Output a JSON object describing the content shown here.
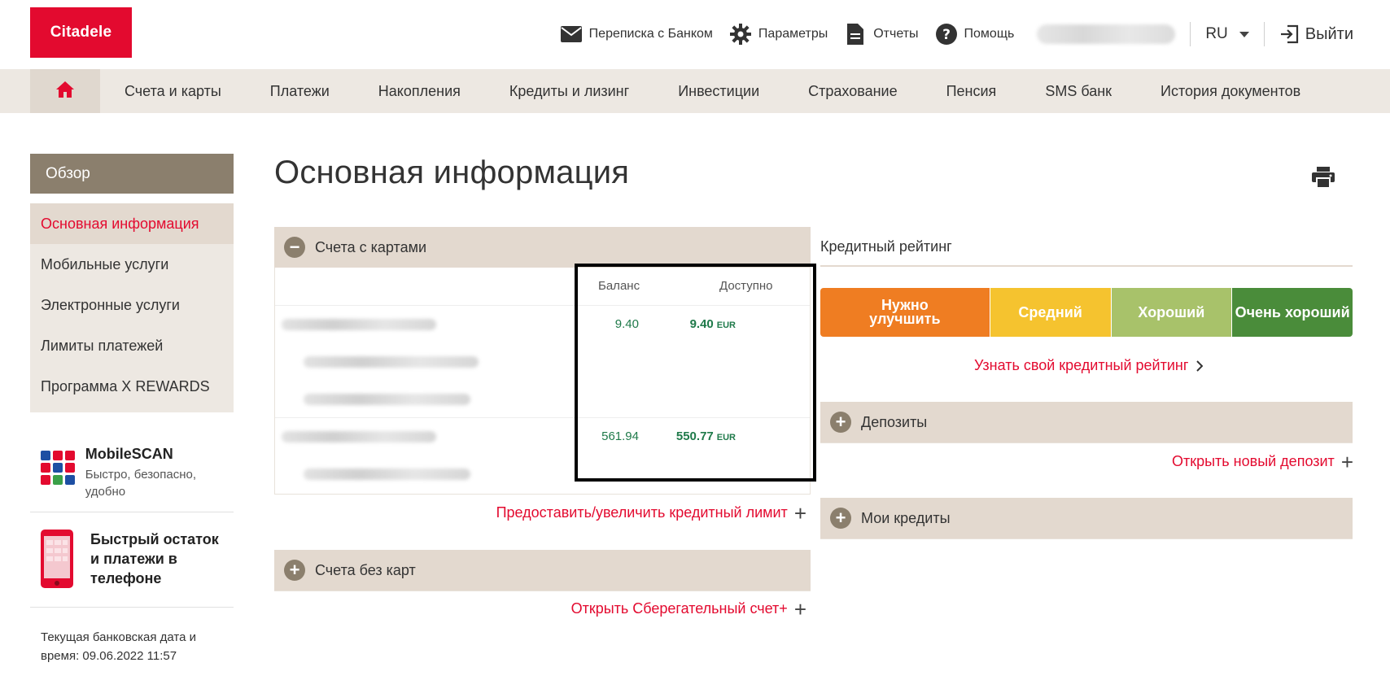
{
  "header": {
    "logo": "Citadele",
    "messages": "Переписка с Банком",
    "settings": "Параметры",
    "reports": "Отчеты",
    "help": "Помощь",
    "language": "RU",
    "logout": "Выйти"
  },
  "nav": {
    "items": [
      "Счета и карты",
      "Платежи",
      "Накопления",
      "Кредиты и лизинг",
      "Инвестиции",
      "Страхование",
      "Пенсия",
      "SMS банк",
      "История документов"
    ]
  },
  "sidebar": {
    "header": "Обзор",
    "items": [
      "Основная информация",
      "Мобильные услуги",
      "Электронные услуги",
      "Лимиты платежей",
      "Программа X REWARDS"
    ],
    "promo1": {
      "title": "MobileSCAN",
      "sub": "Быстро, безопасно, удобно"
    },
    "promo2": {
      "title": "Быстрый остаток и платежи в телефоне"
    },
    "bankdate": "Текущая банковская дата и время: 09.06.2022 11:57"
  },
  "main": {
    "title": "Основная информация",
    "cards_section": "Счета с картами",
    "col_balance": "Баланс",
    "col_available": "Доступно",
    "accounts": [
      {
        "balance": "9.40",
        "available": "9.40",
        "currency": "EUR"
      },
      {
        "balance": "561.94",
        "available": "550.77",
        "currency": "EUR"
      }
    ],
    "credit_limit_link": "Предоставить/увеличить кредитный лимит",
    "no_cards_section": "Счета без карт",
    "savings_link": "Открыть Сберегательный счет+"
  },
  "right": {
    "credit_rating_title": "Кредитный рейтинг",
    "rating_levels": [
      {
        "label": "Нужно улучшить",
        "color": "#ef7d22"
      },
      {
        "label": "Средний",
        "color": "#f5c32f"
      },
      {
        "label": "Хороший",
        "color": "#a8c26a"
      },
      {
        "label": "Очень хороший",
        "color": "#4a8c3a"
      }
    ],
    "rating_link": "Узнать свой кредитный рейтинг",
    "deposits_section": "Депозиты",
    "new_deposit_link": "Открыть новый депозит",
    "loans_section": "Мои кредиты"
  }
}
